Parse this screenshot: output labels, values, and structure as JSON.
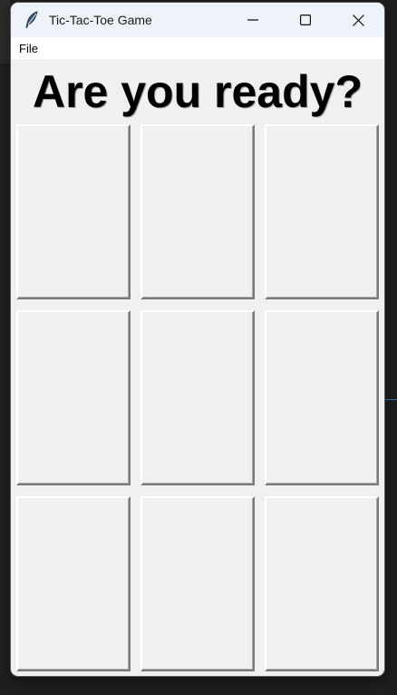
{
  "window": {
    "title": "Tic-Tac-Toe Game",
    "icon": "feather-icon",
    "controls": [
      "minimize-icon",
      "maximize-icon",
      "close-icon"
    ]
  },
  "menu": {
    "items": [
      {
        "label": "File"
      }
    ]
  },
  "game": {
    "heading": "Are you ready?",
    "cells": [
      "",
      "",
      "",
      "",
      "",
      "",
      "",
      "",
      ""
    ]
  },
  "colors": {
    "window_bg": "#f0f0f0",
    "titlebar_bg": "#eef2f9",
    "menubar_bg": "#ffffff",
    "desktop_bg": "#1e1e1e"
  }
}
